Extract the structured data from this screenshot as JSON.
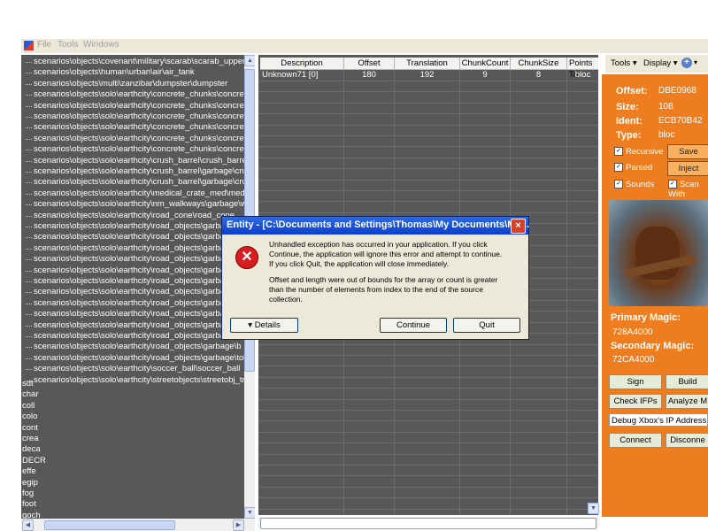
{
  "menu": [
    "File",
    "Tools",
    "Windows"
  ],
  "tree": {
    "nodes": [
      "scenarios\\objects\\covenant\\military\\scarab\\scarab_upper_gun\\",
      "scenarios\\objects\\human\\urban\\air\\air_tank",
      "scenarios\\objects\\multi\\zanzibar\\dumpster\\dumpster",
      "scenarios\\objects\\solo\\earthcity\\concrete_chunks\\concrete_ch",
      "scenarios\\objects\\solo\\earthcity\\concrete_chunks\\concrete_ch",
      "scenarios\\objects\\solo\\earthcity\\concrete_chunks\\concrete_ch",
      "scenarios\\objects\\solo\\earthcity\\concrete_chunks\\concrete_ch",
      "scenarios\\objects\\solo\\earthcity\\concrete_chunks\\concrete_ch",
      "scenarios\\objects\\solo\\earthcity\\concrete_chunks\\concrete_ch",
      "scenarios\\objects\\solo\\earthcity\\crush_barrel\\crush_barrel\\crus",
      "scenarios\\objects\\solo\\earthcity\\crush_barrel\\garbage\\crush_ba",
      "scenarios\\objects\\solo\\earthcity\\crush_barrel\\garbage\\crush_ba",
      "scenarios\\objects\\solo\\earthcity\\medical_crate_med\\medical_cr",
      "scenarios\\objects\\solo\\earthcity\\nm_walkways\\garbage\\walkwa",
      "scenarios\\objects\\solo\\earthcity\\road_cone\\road_cone",
      "scenarios\\objects\\solo\\earthcity\\road_objects\\garbage\\b",
      "scenarios\\objects\\solo\\earthcity\\road_objects\\garbage\\b",
      "scenarios\\objects\\solo\\earthcity\\road_objects\\garbage\\b",
      "scenarios\\objects\\solo\\earthcity\\road_objects\\garbage\\b",
      "scenarios\\objects\\solo\\earthcity\\road_objects\\garbage\\b",
      "scenarios\\objects\\solo\\earthcity\\road_objects\\garbage\\b",
      "scenarios\\objects\\solo\\earthcity\\road_objects\\garbage\\b",
      "scenarios\\objects\\solo\\earthcity\\road_objects\\garbage\\b",
      "scenarios\\objects\\solo\\earthcity\\road_objects\\garbage\\b",
      "scenarios\\objects\\solo\\earthcity\\road_objects\\garbage\\b",
      "scenarios\\objects\\solo\\earthcity\\road_objects\\garbage\\b",
      "scenarios\\objects\\solo\\earthcity\\road_objects\\garbage\\b",
      "scenarios\\objects\\solo\\earthcity\\road_objects\\garbage\\toll_boo",
      "scenarios\\objects\\solo\\earthcity\\soccer_ball\\soccer_ball",
      "scenarios\\objects\\solo\\earthcity\\streetobjects\\streetobj_trashca"
    ],
    "roots": [
      "sdt",
      "char",
      "coll",
      "colo",
      "cont",
      "crea",
      "deca",
      "DECR",
      "effe",
      "egip",
      "fog",
      "foot",
      "goch"
    ]
  },
  "grid": {
    "columns": [
      "Description",
      "Offset",
      "Translation",
      "ChunkCount",
      "ChunkSize",
      "Points To"
    ],
    "rows": [
      [
        "Unknown71 [0]",
        "180",
        "192",
        "9",
        "8",
        "bloc"
      ]
    ]
  },
  "toolbar": {
    "tools": "Tools",
    "display": "Display"
  },
  "info": {
    "offset_label": "Offset:",
    "offset": "DBE0968",
    "size_label": "Size:",
    "size": "108",
    "ident_label": "Ident:",
    "ident": "ECB70B42",
    "type_label": "Type:",
    "type": "bloc"
  },
  "options": {
    "recursive": "Recursive",
    "parsed": "Parsed",
    "sounds": "Sounds",
    "scan_with": "Scan With",
    "save": "Save",
    "inject": "Inject"
  },
  "magic": {
    "primary_label": "Primary Magic:",
    "primary": "728A4000",
    "secondary_label": "Secondary Magic:",
    "secondary": "72CA4000"
  },
  "actions": {
    "sign": "Sign",
    "build": "Build",
    "check_ifps": "Check IFPs",
    "analyze": "Analyze M",
    "debug_placeholder": "Debug  Xbox's  IP  Address",
    "connect": "Connect",
    "disconnect": "Disconne"
  },
  "dialog": {
    "title": "Entity - [C:\\Documents and Settings\\Thomas\\My Documents\\Mo...",
    "line1": "Unhandled exception has occurred in your application. If you click",
    "line2": "Continue, the application will ignore this error and attempt to continue.",
    "line3": "If you click Quit, the application will close immediately.",
    "line4": "Offset and length were out of bounds for the array or count is greater",
    "line5": "than the number of elements from index to the end of the source",
    "line6": "collection.",
    "details": "Details",
    "continue": "Continue",
    "quit": "Quit"
  }
}
